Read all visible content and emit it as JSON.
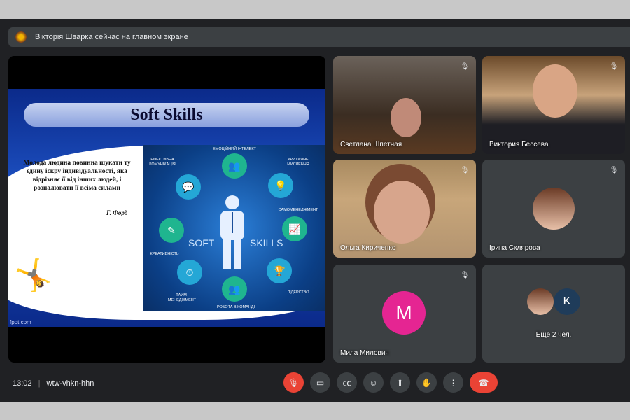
{
  "banner": {
    "text": "Вікторія Шварка сейчас на главном экране",
    "icon": "presenter-avatar"
  },
  "slide": {
    "title": "Soft Skills",
    "quote": "Молода людина повинна шукати ту єдину іскру індивідуальності, яка відрізняє її від інших людей, і розпалювати її всіма силами",
    "author": "Г. Форд",
    "source": "fppt.com",
    "soft": "SOFT",
    "skills": "SKILLS",
    "skills_list": [
      "Емоційний інтелект",
      "Критичне мислення",
      "Самоменеджмент",
      "Лідерство",
      "Робота в команді",
      "Тайм-менеджмент",
      "Креативність",
      "Ефективна комунікація"
    ]
  },
  "participants": [
    {
      "name": "Светлана Шпетная"
    },
    {
      "name": "Виктория Бессева"
    },
    {
      "name": "Ольга Кириченко"
    },
    {
      "name": "Ірина Склярова"
    },
    {
      "name": "Мила Милович",
      "initial": "M",
      "color": "#e52592"
    },
    {
      "name": "Ещё 2 чел.",
      "initial": "K",
      "color": "#1a73e8"
    }
  ],
  "bottom": {
    "time": "13:02",
    "separator": "|",
    "meeting_code": "wtw-vhkn-hhn"
  }
}
